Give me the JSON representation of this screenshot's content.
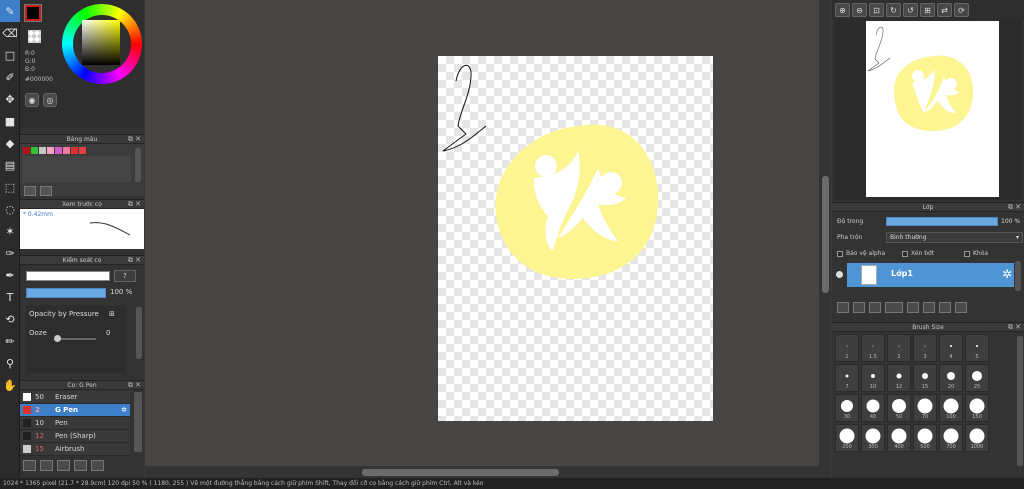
{
  "tools": [
    {
      "name": "brush-icon",
      "glyph": "✎",
      "active": true
    },
    {
      "name": "eraser-icon",
      "glyph": "⌫"
    },
    {
      "name": "selection-rect-icon",
      "glyph": "□"
    },
    {
      "name": "brush-alt-icon",
      "glyph": "✐"
    },
    {
      "name": "move-icon",
      "glyph": "✥"
    },
    {
      "name": "fill-rect-icon",
      "glyph": "■"
    },
    {
      "name": "bucket-icon",
      "glyph": "◆"
    },
    {
      "name": "gradient-icon",
      "glyph": "▤"
    },
    {
      "name": "select-rect-icon",
      "glyph": "⬚"
    },
    {
      "name": "lasso-icon",
      "glyph": "◌"
    },
    {
      "name": "magic-wand-icon",
      "glyph": "✶"
    },
    {
      "name": "select-pen-icon",
      "glyph": "✑"
    },
    {
      "name": "select-eraser-icon",
      "glyph": "✒"
    },
    {
      "name": "text-icon",
      "glyph": "T"
    },
    {
      "name": "transform-icon",
      "glyph": "⟲"
    },
    {
      "name": "ruler-pen-icon",
      "glyph": "✏"
    },
    {
      "name": "eyedropper-icon",
      "glyph": "⚲"
    },
    {
      "name": "hand-icon",
      "glyph": "✋"
    }
  ],
  "color": {
    "r": "R:0",
    "g": "G:0",
    "b": "B:0",
    "hex": "#000000",
    "foreground": "#000000"
  },
  "palette": {
    "title": "Bảng màu",
    "swatches": [
      "#b01414",
      "#36c236",
      "#c6c6c6",
      "#f2a2c2",
      "#d25dc9",
      "#ee7aa0",
      "#dd3030",
      "#e04040"
    ]
  },
  "brush_preview": {
    "title": "Xem trước cọ",
    "size": "* 0.42mm"
  },
  "brush_control": {
    "title": "Kiểm soát cọ",
    "q": "?",
    "opacity": "100 %",
    "opacity_pressure": "Opacity by Pressure",
    "ooze": "Ooze",
    "ooze_val": "0"
  },
  "pens": {
    "title": "Cọ: G Pen",
    "rows": [
      {
        "num": "50",
        "name": "Eraser",
        "color": "#ffffff",
        "sel": false,
        "red": false
      },
      {
        "num": "2",
        "name": "G Pen",
        "color": "#e03030",
        "sel": true,
        "red": true
      },
      {
        "num": "10",
        "name": "Pen",
        "color": "#222222",
        "sel": false,
        "red": false
      },
      {
        "num": "12",
        "name": "Pen (Sharp)",
        "color": "#222222",
        "sel": false,
        "red": true
      },
      {
        "num": "15",
        "name": "Airbrush",
        "color": "#cccccc",
        "sel": false,
        "red": true
      }
    ]
  },
  "navigator": {
    "buttons": [
      "⊕",
      "⊖",
      "⊡",
      "↻",
      "↺",
      "⊞",
      "⇄",
      "⟳"
    ]
  },
  "layers": {
    "title": "Lớp",
    "opacity_label": "Độ trong",
    "opacity_value": "100 %",
    "blend_label": "Pha trộn",
    "blend_value": "Bình thường",
    "protect_alpha": "Bảo vệ alpha",
    "clipping": "Xén bớt",
    "lock": "Khóa",
    "layer_name": "Lớp1",
    "opacity_fraction": 1.0
  },
  "brush_size": {
    "title": "Brush Size",
    "sizes": [
      {
        "label": "1",
        "d": 1
      },
      {
        "label": "1.5",
        "d": 1
      },
      {
        "label": "2",
        "d": 1
      },
      {
        "label": "3",
        "d": 1
      },
      {
        "label": "4",
        "d": 2
      },
      {
        "label": "5",
        "d": 2
      },
      {
        "label": "7",
        "d": 3
      },
      {
        "label": "10",
        "d": 4
      },
      {
        "label": "12",
        "d": 5
      },
      {
        "label": "15",
        "d": 6
      },
      {
        "label": "20",
        "d": 8
      },
      {
        "label": "25",
        "d": 10
      },
      {
        "label": "30",
        "d": 12
      },
      {
        "label": "40",
        "d": 13
      },
      {
        "label": "50",
        "d": 14
      },
      {
        "label": "70",
        "d": 15
      },
      {
        "label": "100",
        "d": 15
      },
      {
        "label": "150",
        "d": 15
      },
      {
        "label": "200",
        "d": 15
      },
      {
        "label": "300",
        "d": 15
      },
      {
        "label": "400",
        "d": 15
      },
      {
        "label": "500",
        "d": 15
      },
      {
        "label": "700",
        "d": 15
      },
      {
        "label": "1000",
        "d": 15
      }
    ]
  },
  "status": "1024 * 1365 pixel   (21.7 * 28.9cm)   120 dpi   50 %   ( 1180, 255 )   Vẽ một đường thẳng bằng cách giữ phím Shift, Thay đổi cỡ cọ bằng cách giữ phím Ctrl, Alt và kéo"
}
